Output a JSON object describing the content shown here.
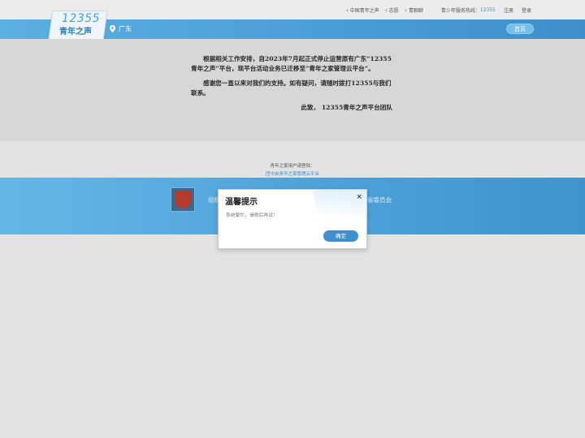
{
  "topbar": {
    "links": [
      "中国青年之声",
      "志愿",
      "青聊聊"
    ],
    "hotline_label": "青少年服务热线：",
    "hotline_number": "12355",
    "separator": "|",
    "register": "注册",
    "login": "登录"
  },
  "header": {
    "logo_number": "12355",
    "logo_text": "青年之声",
    "location": "广东",
    "home_button": "首页"
  },
  "notice": {
    "paragraph1": "根据相关工作安排，自2023年7月起正式停止运营原有广东“12355青年之声”平台，现平台活动业务已迁移至“青年之家管理云平台”。",
    "paragraph2": "感谢您一直以来对我们的支持。如有疑问，请随时拨打12355与我们联系。",
    "signature": "此致，  12355青年之声平台团队"
  },
  "user_entry": {
    "label": "青年之家用户请登陆：",
    "link": "团中央青年之家管理云平台"
  },
  "footer": {
    "left_text": "组织",
    "right_text": "省委员会"
  },
  "modal": {
    "title": "温馨提示",
    "close": "×",
    "message": "系统繁忙，请稍后再试！",
    "ok_button": "确定"
  },
  "colors": {
    "header_blue": "#4a9ed6",
    "link_blue": "#3a8ecc",
    "ok_button": "#3f8fcc"
  }
}
